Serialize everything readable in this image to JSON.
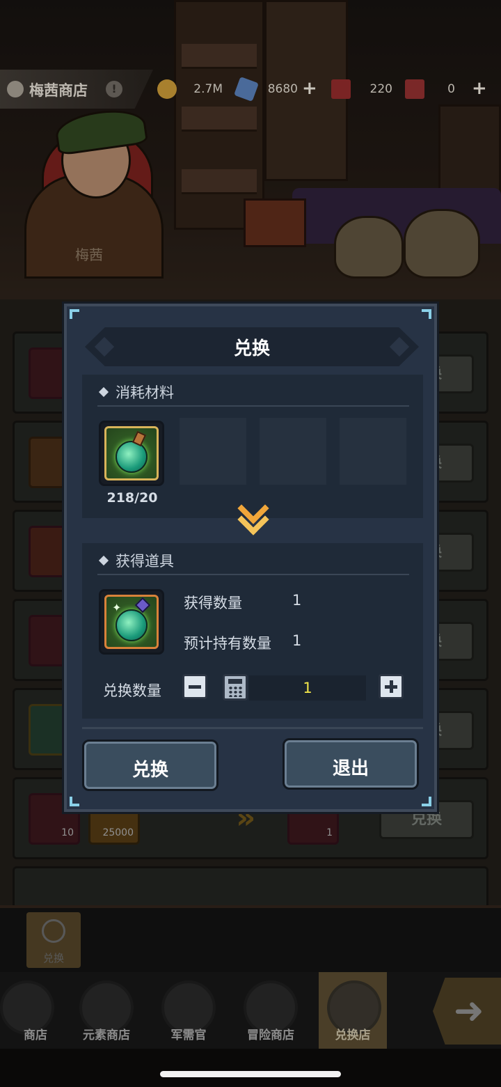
{
  "topbar": {
    "shop_title": "梅茜商店",
    "info_icon": "!",
    "gold": "2.7M",
    "crystal": "8680",
    "ticket": "220",
    "card": "0",
    "colors": {
      "gold": "#d5a13a",
      "crystal": "#5a8ad8",
      "ticket": "#b03030",
      "card": "#b03838"
    }
  },
  "npc": {
    "name": "梅茜"
  },
  "background_rows": [
    {
      "button": "兑换"
    },
    {
      "button": "兑换"
    },
    {
      "button": "兑换"
    },
    {
      "button": "兑换"
    },
    {
      "button": "兑换"
    },
    {
      "button": "兑换",
      "item_counts": [
        "10",
        "25000",
        "1"
      ]
    }
  ],
  "modal": {
    "title": "兑换",
    "cost_section_label": "消耗材料",
    "cost_item": {
      "icon": "green-potion-icon",
      "quantity": "218/20"
    },
    "gain_section_label": "获得道具",
    "gain_item": {
      "icon": "serpent-potion-icon"
    },
    "gain_count_label": "获得数量",
    "gain_count_value": "1",
    "expected_hold_label": "预计持有数量",
    "expected_hold_value": "1",
    "exchange_qty_label": "兑换数量",
    "exchange_qty_value": "1",
    "confirm_button": "兑换",
    "exit_button": "退出"
  },
  "subtab": {
    "label": "兑换"
  },
  "nav": {
    "items": [
      {
        "label": "商店"
      },
      {
        "label": "元素商店"
      },
      {
        "label": "军需官"
      },
      {
        "label": "冒险商店"
      },
      {
        "label": "兑换店",
        "active": true
      }
    ]
  }
}
